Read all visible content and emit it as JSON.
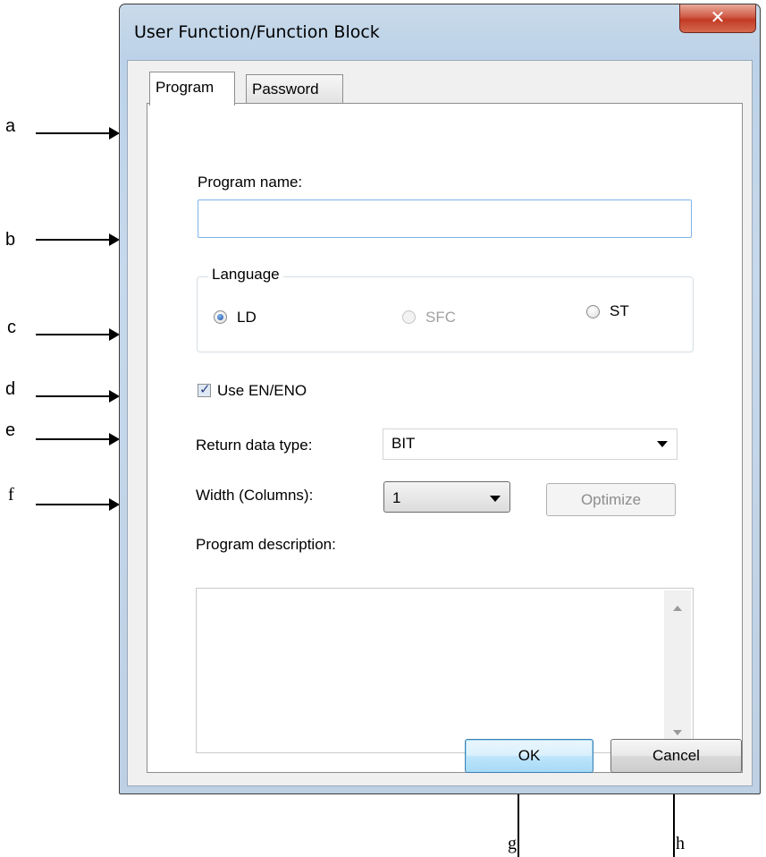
{
  "window": {
    "title": "User Function/Function Block",
    "close_glyph": "✕"
  },
  "tabs": [
    {
      "label": "Program",
      "selected": true
    },
    {
      "label": "Password",
      "selected": false
    }
  ],
  "form": {
    "program_name_label": "Program name:",
    "program_name_value": "",
    "language": {
      "group_label": "Language",
      "options": [
        {
          "label": "LD",
          "checked": true,
          "enabled": true
        },
        {
          "label": "SFC",
          "checked": false,
          "enabled": false
        },
        {
          "label": "ST",
          "checked": false,
          "enabled": true
        }
      ]
    },
    "use_en_eno": {
      "label": "Use EN/ENO",
      "checked": true
    },
    "return_type": {
      "label": "Return data type:",
      "value": "BIT"
    },
    "width": {
      "label": "Width (Columns):",
      "value": "1"
    },
    "optimize_label": "Optimize",
    "description_label": "Program description:",
    "description_value": ""
  },
  "buttons": {
    "ok": "OK",
    "cancel": "Cancel"
  },
  "callouts": {
    "a": "a",
    "b": "b",
    "c": "c",
    "d": "d",
    "e": "e",
    "f": "f",
    "g": "g",
    "h": "h"
  },
  "icons": {
    "close": "close-icon",
    "combo_arrow": "chevron-down-icon",
    "scroll_up": "scroll-up-arrow-icon",
    "scroll_down": "scroll-down-arrow-icon",
    "checkmark": "checkmark-icon"
  }
}
